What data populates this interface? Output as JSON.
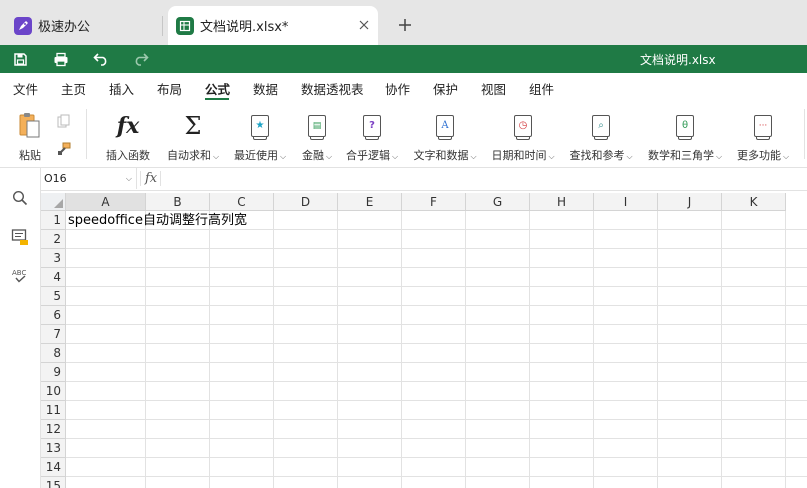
{
  "browser_tabs": [
    {
      "title": "极速办公",
      "icon": "rocket-icon"
    },
    {
      "title": "文档说明.xlsx*",
      "icon": "spreadsheet-icon",
      "active": true
    }
  ],
  "title_bar": {
    "document_title": "文档说明.xlsx",
    "brand_color": "#1f7a45"
  },
  "menu": {
    "items": [
      "文件",
      "主页",
      "插入",
      "布局",
      "公式",
      "数据",
      "数据透视表",
      "协作",
      "保护",
      "视图",
      "组件"
    ],
    "active": "公式"
  },
  "ribbon": {
    "paste": "粘贴",
    "insert_function": "插入函数",
    "autosum": "自动求和",
    "recent": "最近使用",
    "financial": "金融",
    "logical": "合乎逻辑",
    "text_data": "文字和数据",
    "datetime": "日期和时间",
    "lookup": "查找和参考",
    "math": "数学和三角学",
    "more": "更多功能"
  },
  "formula_bar": {
    "name_box": "O16",
    "fx": "fx",
    "formula": ""
  },
  "sheet": {
    "columns": [
      "A",
      "B",
      "C",
      "D",
      "E",
      "F",
      "G",
      "H",
      "I",
      "J",
      "K"
    ],
    "rows": [
      "1",
      "2",
      "3",
      "4",
      "5",
      "6",
      "7",
      "8",
      "9",
      "10",
      "11",
      "12",
      "13",
      "14",
      "15"
    ],
    "cells": {
      "A1": "speedoffice自动调整行高列宽"
    },
    "selected_column": "A"
  }
}
